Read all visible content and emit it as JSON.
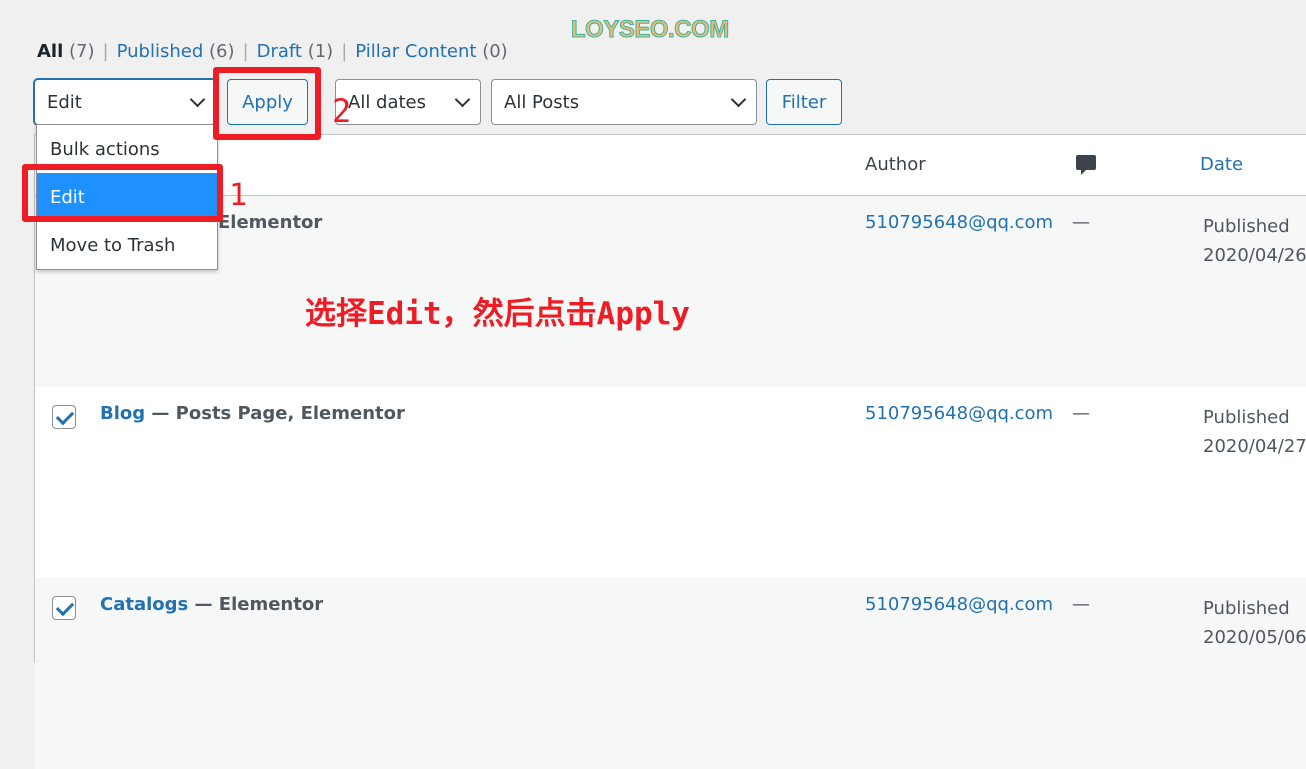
{
  "watermark": "LOYSEO.COM",
  "filters": [
    {
      "label": "All",
      "count": "(7)"
    },
    {
      "label": "Published",
      "count": "(6)"
    },
    {
      "label": "Draft",
      "count": "(1)"
    },
    {
      "label": "Pillar Content",
      "count": "(0)"
    }
  ],
  "toolbar": {
    "bulk_value": "Edit",
    "apply": "Apply",
    "dates": "All dates",
    "post_type": "All Posts",
    "filter": "Filter"
  },
  "dropdown": {
    "options": [
      "Bulk actions",
      "Edit",
      "Move to Trash"
    ],
    "selected": "Edit"
  },
  "columns": {
    "author": "Author",
    "comments_icon": "comment-bubble-icon",
    "date": "Date"
  },
  "rows": [
    {
      "title": "",
      "suffix": "Elementor",
      "author": "510795648@qq.com",
      "comments": "—",
      "status": "Published",
      "date": "2020/04/26"
    },
    {
      "title": "Blog",
      "suffix": " — Posts Page, Elementor",
      "author": "510795648@qq.com",
      "comments": "—",
      "status": "Published",
      "date": "2020/04/27",
      "checked": true
    },
    {
      "title": "Catalogs",
      "suffix": " — Elementor",
      "author": "510795648@qq.com",
      "comments": "—",
      "status": "Published",
      "date": "2020/05/06",
      "checked": true
    }
  ],
  "annotations": {
    "step1": "1",
    "step2": "2",
    "instruction": "选择Edit，然后点击Apply"
  },
  "colors": {
    "accent": "#2271b1",
    "annotation": "#ee1c25",
    "selected": "#1e90ff"
  }
}
